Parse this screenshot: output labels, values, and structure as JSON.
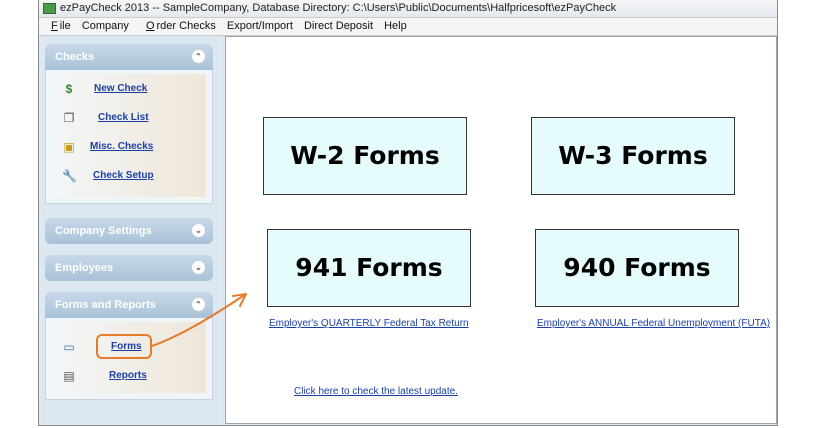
{
  "window": {
    "title": "ezPayCheck 2013 -- SampleCompany, Database Directory: C:\\Users\\Public\\Documents\\Halfpricesoft\\ezPayCheck"
  },
  "menu": [
    {
      "label": "File"
    },
    {
      "label": "Company"
    },
    {
      "label": "Order Checks"
    },
    {
      "label": "Export/Import"
    },
    {
      "label": "Direct Deposit"
    },
    {
      "label": "Help"
    }
  ],
  "sidebar": {
    "checks": {
      "title": "Checks",
      "items": [
        {
          "label": "New Check",
          "icon": "dollar-icon"
        },
        {
          "label": "Check List",
          "icon": "documents-icon"
        },
        {
          "label": "Misc. Checks",
          "icon": "misc-check-icon"
        },
        {
          "label": "Check Setup",
          "icon": "wrench-icon"
        }
      ]
    },
    "company_settings": {
      "title": "Company Settings"
    },
    "employees": {
      "title": "Employees"
    },
    "forms_reports": {
      "title": "Forms and Reports",
      "items": [
        {
          "label": "Forms",
          "icon": "forms-icon"
        },
        {
          "label": "Reports",
          "icon": "reports-icon"
        }
      ]
    }
  },
  "main": {
    "w2": "W-2 Forms",
    "w3": "W-3 Forms",
    "f941": "941 Forms",
    "f940": "940 Forms",
    "f941_link": "Employer's QUARTERLY Federal Tax Return",
    "f940_link": "Employer's ANNUAL Federal Unemployment (FUTA)",
    "update_link": "Click here to check the latest update."
  },
  "colors": {
    "accent_orange": "#e47c2b",
    "link_blue": "#1a3fa6",
    "form_button_bg": "#e6fbfb"
  }
}
